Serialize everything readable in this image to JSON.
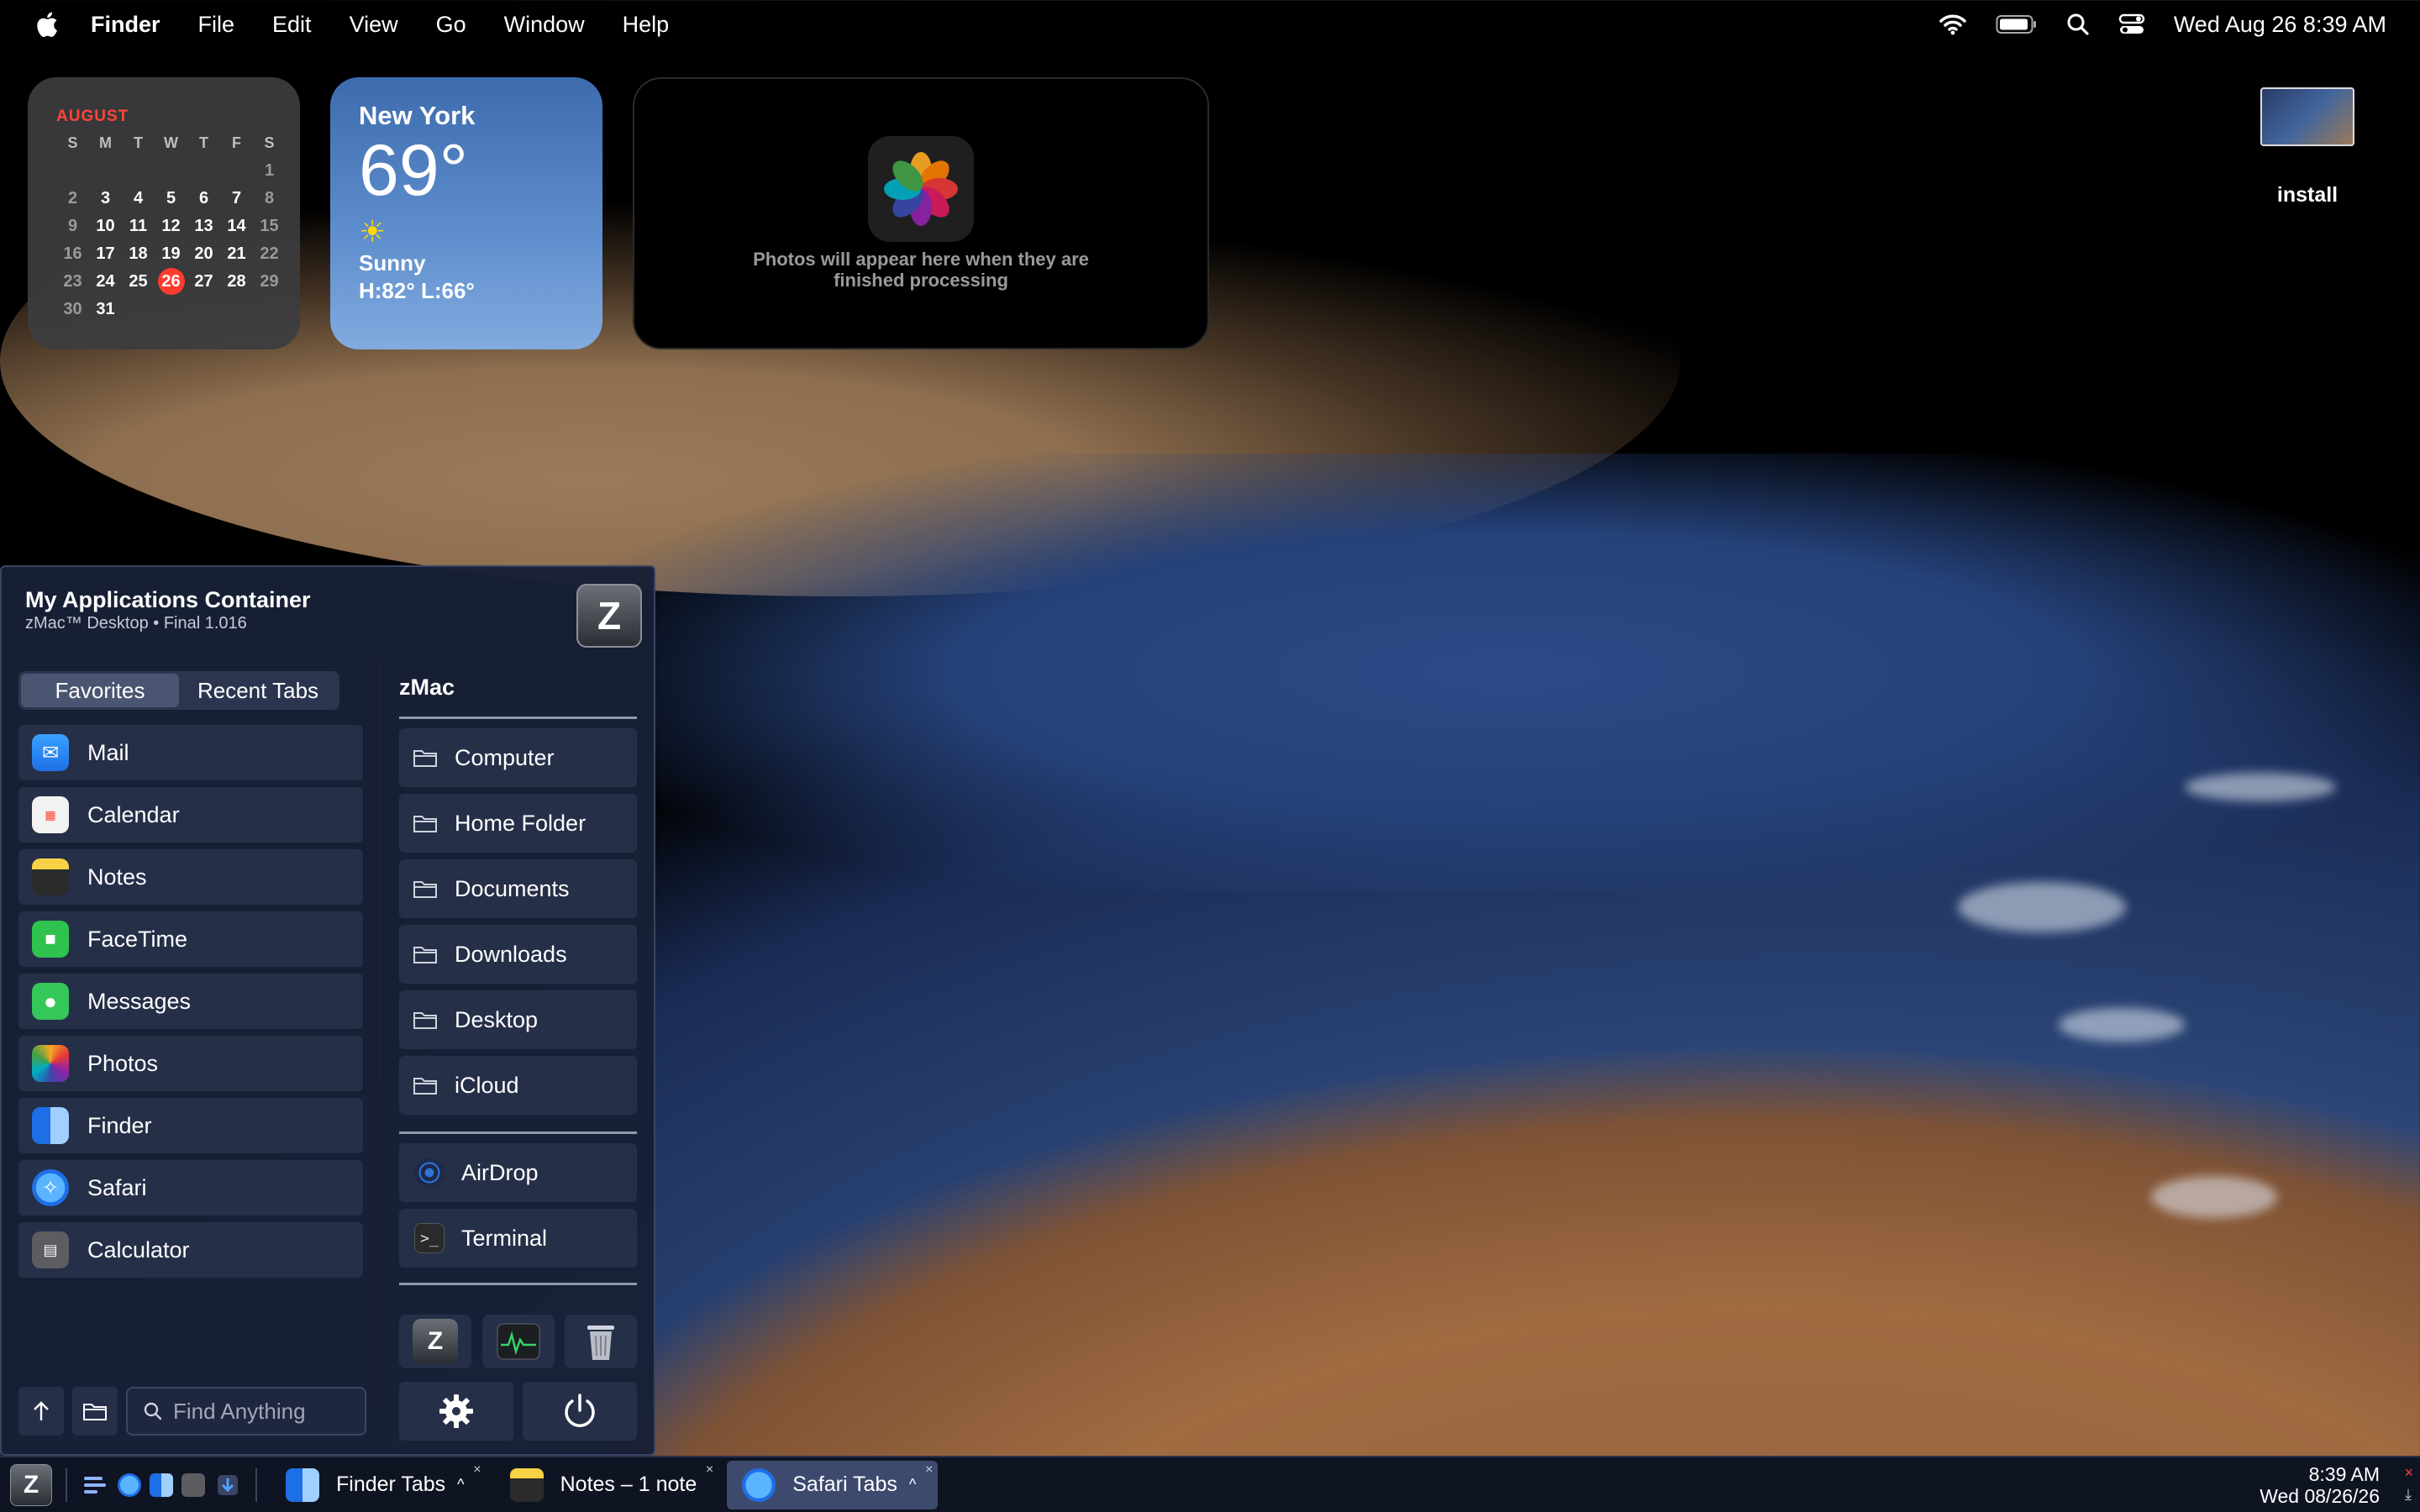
{
  "menubar": {
    "app": "Finder",
    "items": [
      "File",
      "Edit",
      "View",
      "Go",
      "Window",
      "Help"
    ],
    "clock": "Wed Aug 26  8:39 AM"
  },
  "calendar": {
    "month": "AUGUST",
    "dows": [
      "S",
      "M",
      "T",
      "W",
      "T",
      "F",
      "S"
    ],
    "days": [
      "",
      "",
      "",
      "",
      "",
      "",
      "1",
      "2",
      "3",
      "4",
      "5",
      "6",
      "7",
      "8",
      "9",
      "10",
      "11",
      "12",
      "13",
      "14",
      "15",
      "16",
      "17",
      "18",
      "19",
      "20",
      "21",
      "22",
      "23",
      "24",
      "25",
      "26",
      "27",
      "28",
      "29",
      "30",
      "31"
    ],
    "today": "26"
  },
  "weather": {
    "city": "New York",
    "temp": "69°",
    "condition": "Sunny",
    "hilo": "H:82° L:66°",
    "icon": "sun-icon"
  },
  "photos_widget": {
    "message": "Photos will appear here when they are finished processing"
  },
  "desktop": {
    "install_label": "install"
  },
  "launcher": {
    "title": "My Applications Container",
    "subtitle": "zMac™ Desktop • Final 1.016",
    "logo": "Z",
    "tabs": [
      "Favorites",
      "Recent Tabs"
    ],
    "favorites": [
      {
        "label": "Mail",
        "icon": "mail-icon",
        "color": "#2f7cf6"
      },
      {
        "label": "Calendar",
        "icon": "calendar-icon",
        "color": "#f2f2f2"
      },
      {
        "label": "Notes",
        "icon": "notes-icon",
        "color": "#f7d246"
      },
      {
        "label": "FaceTime",
        "icon": "facetime-icon",
        "color": "#30c24e"
      },
      {
        "label": "Messages",
        "icon": "messages-icon",
        "color": "#34c759"
      },
      {
        "label": "Photos",
        "icon": "photos-icon",
        "color": "#ffffff"
      },
      {
        "label": "Finder",
        "icon": "finder-icon",
        "color": "#3aa0f5"
      },
      {
        "label": "Safari",
        "icon": "safari-icon",
        "color": "#1e8cf0"
      },
      {
        "label": "Calculator",
        "icon": "calculator-icon",
        "color": "#6e6e72"
      }
    ],
    "section_title": "zMac",
    "folders": [
      "Computer",
      "Home Folder",
      "Documents",
      "Downloads",
      "Desktop",
      "iCloud"
    ],
    "tools": [
      {
        "label": "AirDrop",
        "icon": "airdrop-icon"
      },
      {
        "label": "Terminal",
        "icon": "terminal-icon"
      }
    ],
    "search_placeholder": "Find Anything"
  },
  "taskbar": {
    "logo": "Z",
    "tasks": [
      {
        "label": "Finder Tabs",
        "icon": "finder-icon",
        "caret": "^",
        "active": false
      },
      {
        "label": "Notes – 1 note",
        "icon": "notes-icon",
        "caret": "",
        "active": false
      },
      {
        "label": "Safari Tabs",
        "icon": "safari-icon",
        "caret": "^",
        "active": true
      }
    ],
    "close_glyph": "×",
    "time": "8:39 AM",
    "date": "Wed 08/26/26"
  }
}
